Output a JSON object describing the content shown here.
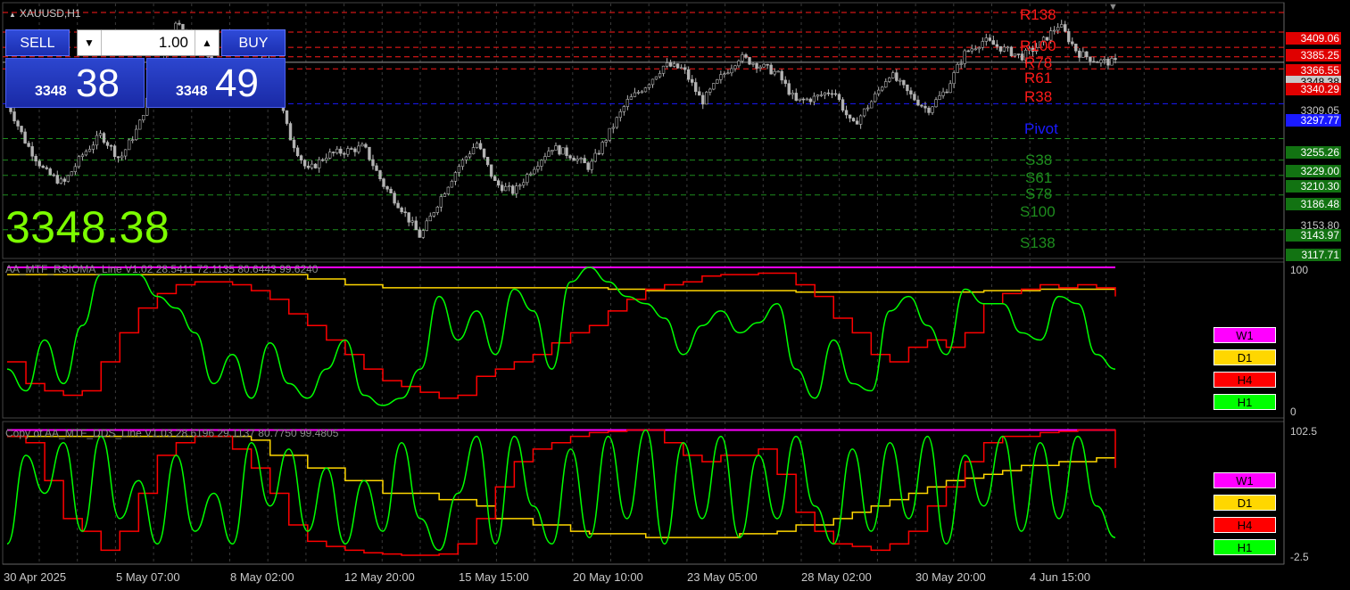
{
  "symbol_title": "XAUUSD,H1",
  "trade_panel": {
    "sell_label": "SELL",
    "buy_label": "BUY",
    "lot_value": "1.00",
    "bid_small": "3348",
    "bid_big": "38",
    "ask_small": "3348",
    "ask_big": "49"
  },
  "current_price": "3348.38",
  "levels": {
    "R138": "R138",
    "R100": "R100",
    "R78": "R78",
    "R61": "R61",
    "R38": "R38",
    "Pivot": "Pivot",
    "S38": "S38",
    "S61": "S61",
    "S78": "S78",
    "S100": "S100",
    "S138": "S138"
  },
  "price_scale": {
    "r138": "3409.06",
    "r100": "3385.25",
    "r78": "3366.55",
    "cur": "3348.38",
    "r38": "3340.29",
    "t3309": "3309.05",
    "pivot": "3297.77",
    "s38": "3255.26",
    "s61": "3229.00",
    "s78": "3210.30",
    "s100": "3186.48",
    "t3153": "3153.80",
    "s138": "3143.97",
    "s_low": "3117.71"
  },
  "colors": {
    "resistance": "#ff1a1a",
    "support": "#1e8c1e",
    "pivot": "#1a1aff",
    "W1": "#ff00ff",
    "D1": "#ffd700",
    "H4": "#ff0000",
    "H1": "#00ff00"
  },
  "indicator1": {
    "title": "AA_MTF_RSIOMA_Line V1.02 28.5411 72.1135 80.6443 99.6240",
    "scale_top": "100",
    "scale_bottom": "0",
    "legend": [
      "W1",
      "D1",
      "H4",
      "H1"
    ]
  },
  "indicator2": {
    "title": "Copy of AA_MTF_DDS_Line V1.03 28.6196 29.1137 80.7750 99.4805",
    "scale_top": "102.5",
    "scale_bottom": "-2.5",
    "legend": [
      "W1",
      "D1",
      "H4",
      "H1"
    ]
  },
  "dates": [
    "30 Apr 2025",
    "5 May 07:00",
    "8 May 02:00",
    "12 May 20:00",
    "15 May 15:00",
    "20 May 10:00",
    "23 May 05:00",
    "28 May 02:00",
    "30 May 20:00",
    "4 Jun 15:00"
  ],
  "chart_data": [
    {
      "type": "candlestick",
      "title": "XAUUSD,H1",
      "ylim": [
        3110,
        3420
      ],
      "x_ticks": [
        "30 Apr 2025",
        "5 May 07:00",
        "8 May 02:00",
        "12 May 20:00",
        "15 May 15:00",
        "20 May 10:00",
        "23 May 05:00",
        "28 May 02:00",
        "30 May 20:00",
        "4 Jun 15:00"
      ],
      "close_path": [
        3300,
        3250,
        3215,
        3200,
        3235,
        3260,
        3230,
        3270,
        3340,
        3395,
        3380,
        3345,
        3320,
        3345,
        3350,
        3260,
        3215,
        3235,
        3240,
        3245,
        3200,
        3170,
        3135,
        3180,
        3220,
        3250,
        3200,
        3190,
        3220,
        3245,
        3235,
        3220,
        3260,
        3300,
        3320,
        3345,
        3340,
        3300,
        3330,
        3355,
        3345,
        3335,
        3300,
        3305,
        3315,
        3270,
        3300,
        3335,
        3310,
        3290,
        3315,
        3360,
        3375,
        3365,
        3355,
        3370,
        3395,
        3360,
        3350,
        3348
      ],
      "levels": {
        "R138": 3409.06,
        "R100": 3385.25,
        "R78": 3366.55,
        "R61": 3355,
        "R38": 3340.29,
        "Pivot": 3297.77,
        "S38": 3255.26,
        "S61": 3229.0,
        "S78": 3210.3,
        "S100": 3186.48,
        "S138": 3143.97
      },
      "current": 3348.38
    },
    {
      "type": "line",
      "title": "AA_MTF_RSIOMA_Line V1.02 28.5411 72.1135 80.6443 99.6240",
      "ylim": [
        0,
        100
      ],
      "series": [
        {
          "name": "W1",
          "values": [
            100,
            100,
            100,
            100,
            100,
            100,
            100,
            100,
            100,
            100,
            100,
            100,
            100,
            100,
            100,
            100,
            100,
            100,
            100,
            100,
            100,
            100,
            100,
            100,
            100,
            100,
            100,
            100,
            100,
            100,
            100,
            100,
            100,
            100,
            100,
            100,
            100,
            100,
            100,
            100,
            100,
            100,
            100,
            100,
            100,
            100,
            100,
            100,
            100,
            100,
            100,
            100,
            100,
            100,
            100,
            100,
            100,
            100,
            100,
            100
          ]
        },
        {
          "name": "D1",
          "values": [
            95,
            95,
            95,
            95,
            95,
            95,
            95,
            95,
            95,
            95,
            95,
            95,
            95,
            95,
            95,
            95,
            92,
            92,
            88,
            88,
            86,
            86,
            86,
            86,
            86,
            86,
            86,
            86,
            86,
            86,
            86,
            86,
            85,
            85,
            84,
            84,
            84,
            84,
            84,
            84,
            84,
            84,
            83,
            83,
            83,
            83,
            83,
            83,
            83,
            83,
            83,
            83,
            84,
            84,
            84,
            85,
            85,
            85,
            85,
            85
          ]
        },
        {
          "name": "H4",
          "values": [
            35,
            20,
            15,
            12,
            15,
            35,
            55,
            72,
            82,
            88,
            90,
            90,
            88,
            84,
            78,
            68,
            60,
            50,
            40,
            30,
            22,
            18,
            14,
            10,
            12,
            25,
            30,
            35,
            40,
            48,
            55,
            60,
            70,
            78,
            85,
            88,
            90,
            94,
            95,
            95,
            96,
            96,
            88,
            80,
            65,
            55,
            40,
            35,
            45,
            50,
            45,
            55,
            75,
            82,
            85,
            88,
            86,
            88,
            86,
            80
          ]
        },
        {
          "name": "H1",
          "values": [
            30,
            15,
            50,
            20,
            60,
            95,
            95,
            95,
            80,
            72,
            55,
            20,
            40,
            10,
            48,
            20,
            10,
            30,
            50,
            12,
            5,
            10,
            30,
            80,
            50,
            70,
            40,
            85,
            70,
            30,
            90,
            100,
            90,
            80,
            75,
            65,
            40,
            60,
            70,
            55,
            62,
            75,
            30,
            10,
            50,
            20,
            15,
            70,
            80,
            60,
            40,
            85,
            75,
            75,
            55,
            50,
            80,
            75,
            40,
            30
          ]
        }
      ]
    },
    {
      "type": "line",
      "title": "Copy of AA_MTF_DDS_Line V1.03 28.6196 29.1137 80.7750 99.4805",
      "ylim": [
        -2.5,
        102.5
      ],
      "series": [
        {
          "name": "W1",
          "values": [
            100,
            100,
            100,
            100,
            100,
            100,
            100,
            100,
            100,
            100,
            100,
            100,
            100,
            100,
            100,
            100,
            100,
            100,
            100,
            100,
            100,
            100,
            100,
            100,
            100,
            100,
            100,
            100,
            100,
            100,
            100,
            100,
            100,
            100,
            100,
            100,
            100,
            100,
            100,
            100,
            100,
            100,
            100,
            100,
            100,
            100,
            100,
            100,
            100,
            100,
            100,
            100,
            100,
            100,
            100,
            100,
            100,
            100,
            100,
            100
          ]
        },
        {
          "name": "D1",
          "values": [
            95,
            95,
            95,
            95,
            95,
            95,
            95,
            95,
            95,
            95,
            95,
            95,
            95,
            92,
            80,
            80,
            70,
            70,
            60,
            60,
            50,
            50,
            50,
            45,
            45,
            40,
            30,
            30,
            25,
            25,
            20,
            18,
            18,
            18,
            15,
            15,
            15,
            15,
            15,
            18,
            18,
            20,
            25,
            25,
            30,
            35,
            40,
            45,
            50,
            55,
            60,
            62,
            65,
            68,
            72,
            72,
            75,
            75,
            78,
            78
          ]
        },
        {
          "name": "H4",
          "values": [
            95,
            90,
            60,
            30,
            20,
            5,
            20,
            50,
            80,
            90,
            95,
            95,
            85,
            70,
            50,
            25,
            12,
            8,
            5,
            3,
            2,
            1,
            1,
            2,
            10,
            30,
            55,
            75,
            85,
            90,
            95,
            98,
            99,
            100,
            100,
            90,
            80,
            75,
            80,
            80,
            85,
            65,
            35,
            20,
            10,
            8,
            5,
            10,
            20,
            40,
            55,
            75,
            90,
            95,
            95,
            98,
            99,
            100,
            100,
            70
          ]
        },
        {
          "name": "H1",
          "values": [
            10,
            80,
            50,
            90,
            20,
            95,
            30,
            60,
            10,
            80,
            20,
            50,
            10,
            90,
            40,
            85,
            20,
            70,
            10,
            60,
            20,
            90,
            30,
            5,
            50,
            95,
            10,
            95,
            40,
            10,
            85,
            15,
            95,
            30,
            100,
            10,
            90,
            30,
            95,
            15,
            80,
            30,
            95,
            40,
            10,
            85,
            20,
            90,
            30,
            95,
            10,
            80,
            40,
            95,
            20,
            90,
            30,
            95,
            40,
            15
          ]
        }
      ]
    }
  ]
}
